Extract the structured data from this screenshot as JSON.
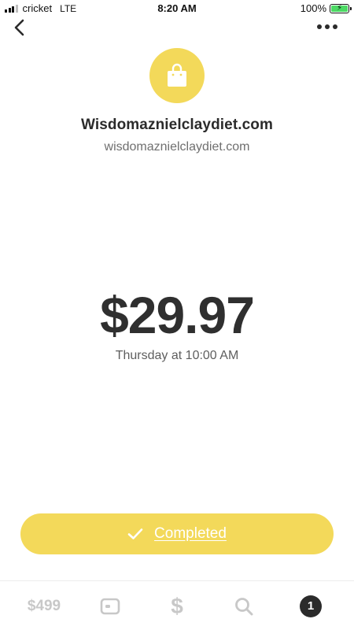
{
  "status_bar": {
    "carrier": "cricket",
    "network": "LTE",
    "time": "8:20 AM",
    "battery_percent": "100%",
    "battery_level": 1.0,
    "battery_color": "#4cd964"
  },
  "nav": {
    "back_icon": "chevron-left-icon",
    "more_icon": "more-dots-icon"
  },
  "merchant": {
    "icon": "shopping-bag-icon",
    "icon_bg_color": "#f3d95a",
    "name": "Wisdomaznielclaydiet.com",
    "domain": "wisdomaznielclaydiet.com"
  },
  "payment": {
    "amount": "$29.97",
    "date": "Thursday at 10:00 AM"
  },
  "status_button": {
    "label": "Completed",
    "icon": "checkmark-icon",
    "color": "#f3d95a"
  },
  "tab_bar": {
    "balance": "$499",
    "card_icon": "card-icon",
    "cash_label": "$",
    "search_icon": "search-icon",
    "activity_count": "1"
  }
}
